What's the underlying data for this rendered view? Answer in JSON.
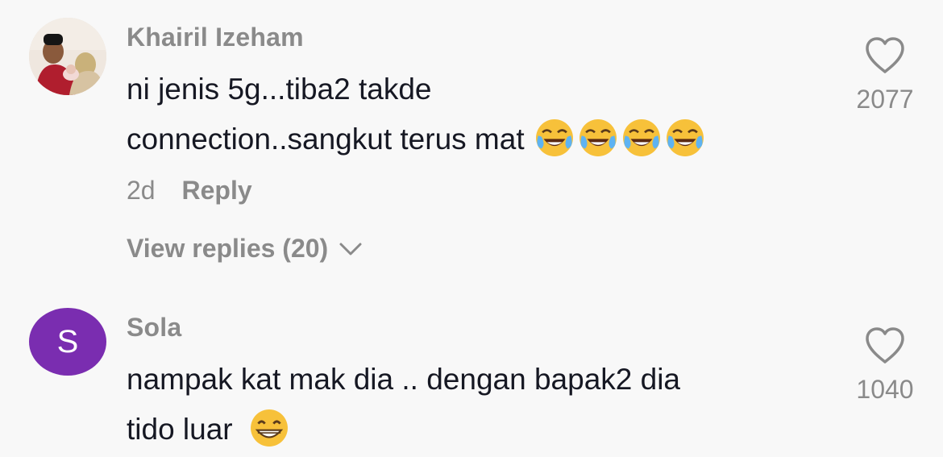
{
  "comments": [
    {
      "username": "Khairil Izeham",
      "text_line1": "ni jenis 5g...tiba2 takde",
      "text_line2": "connection..sangkut terus mat",
      "emoji_after": "face-with-tears-of-joy x4",
      "time": "2d",
      "reply_label": "Reply",
      "view_replies": "View replies (20)",
      "likes": "2077"
    },
    {
      "username": "Sola",
      "avatar_letter": "S",
      "avatar_color": "#7a2db0",
      "text_line1": "nampak kat mak dia .. dengan bapak2 dia",
      "text_line2": "tido luar",
      "emoji_after": "beaming-face-with-smiling-eyes",
      "likes": "1040"
    }
  ]
}
